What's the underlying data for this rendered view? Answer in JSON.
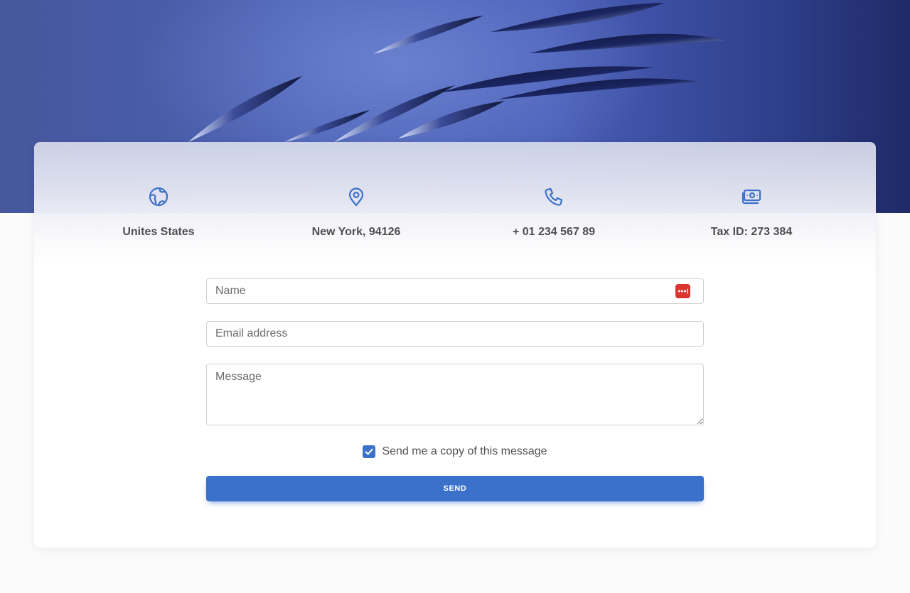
{
  "info": {
    "items": [
      {
        "icon": "globe-icon",
        "label": "Unites States"
      },
      {
        "icon": "location-pin-icon",
        "label": "New York, 94126"
      },
      {
        "icon": "phone-icon",
        "label": "+ 01 234 567 89"
      },
      {
        "icon": "money-bill-icon",
        "label": "Tax ID: 273 384"
      }
    ]
  },
  "form": {
    "name_placeholder": "Name",
    "email_placeholder": "Email address",
    "message_placeholder": "Message",
    "copy_label": "Send me a copy of this message",
    "copy_checked": true,
    "send_label": "SEND"
  },
  "colors": {
    "accent": "#3b71ca",
    "password_manager_icon": "#d8362e"
  }
}
